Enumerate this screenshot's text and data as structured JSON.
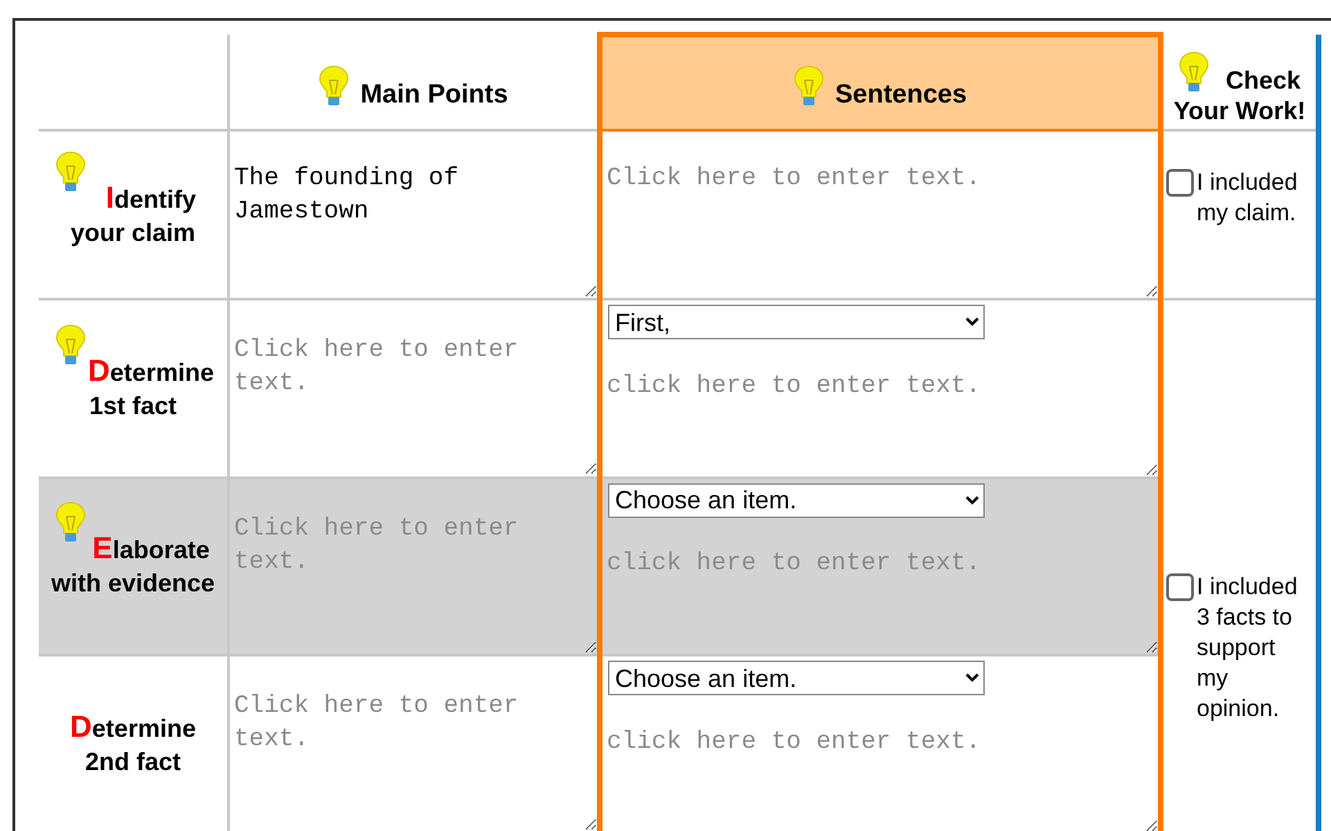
{
  "table": {
    "columns": [
      {
        "kind": "label"
      },
      {
        "label": "Main Points",
        "bulb": true,
        "kind": "points"
      },
      {
        "label": "Sentences",
        "bulb": true,
        "kind": "sentences"
      },
      {
        "label": "Check Your Work!",
        "bulb": true,
        "kind": "check"
      }
    ],
    "rows": [
      {
        "initial": "I",
        "label": "dentify\nyour claim",
        "bulb": true,
        "highlighted": false,
        "main_point": {
          "value": "The founding of Jamestown"
        },
        "sentence": {
          "placeholder": "Click here to enter text."
        }
      },
      {
        "initial": "D",
        "label": "etermine\n1st fact",
        "bulb": true,
        "highlighted": false,
        "main_point": {
          "placeholder": "Click here to enter text."
        },
        "sentence": {
          "dropdown": "First,",
          "placeholder": "click here to enter text."
        }
      },
      {
        "initial": "E",
        "label": "laborate\nwith evidence",
        "bulb": true,
        "highlighted": true,
        "main_point": {
          "placeholder": "Click here to enter text."
        },
        "sentence": {
          "dropdown": "Choose an item.",
          "placeholder": "click here to enter text."
        }
      },
      {
        "initial": "D",
        "label": "etermine\n2nd fact",
        "bulb": false,
        "highlighted": false,
        "main_point": {
          "placeholder": "Click here to enter text."
        },
        "sentence": {
          "dropdown": "Choose an item.",
          "placeholder": "click here to enter text."
        }
      }
    ],
    "checks": [
      {
        "label": "I included my claim.",
        "checked": false
      },
      {
        "label": "I included 3 facts to support my opinion.",
        "checked": false
      }
    ]
  }
}
